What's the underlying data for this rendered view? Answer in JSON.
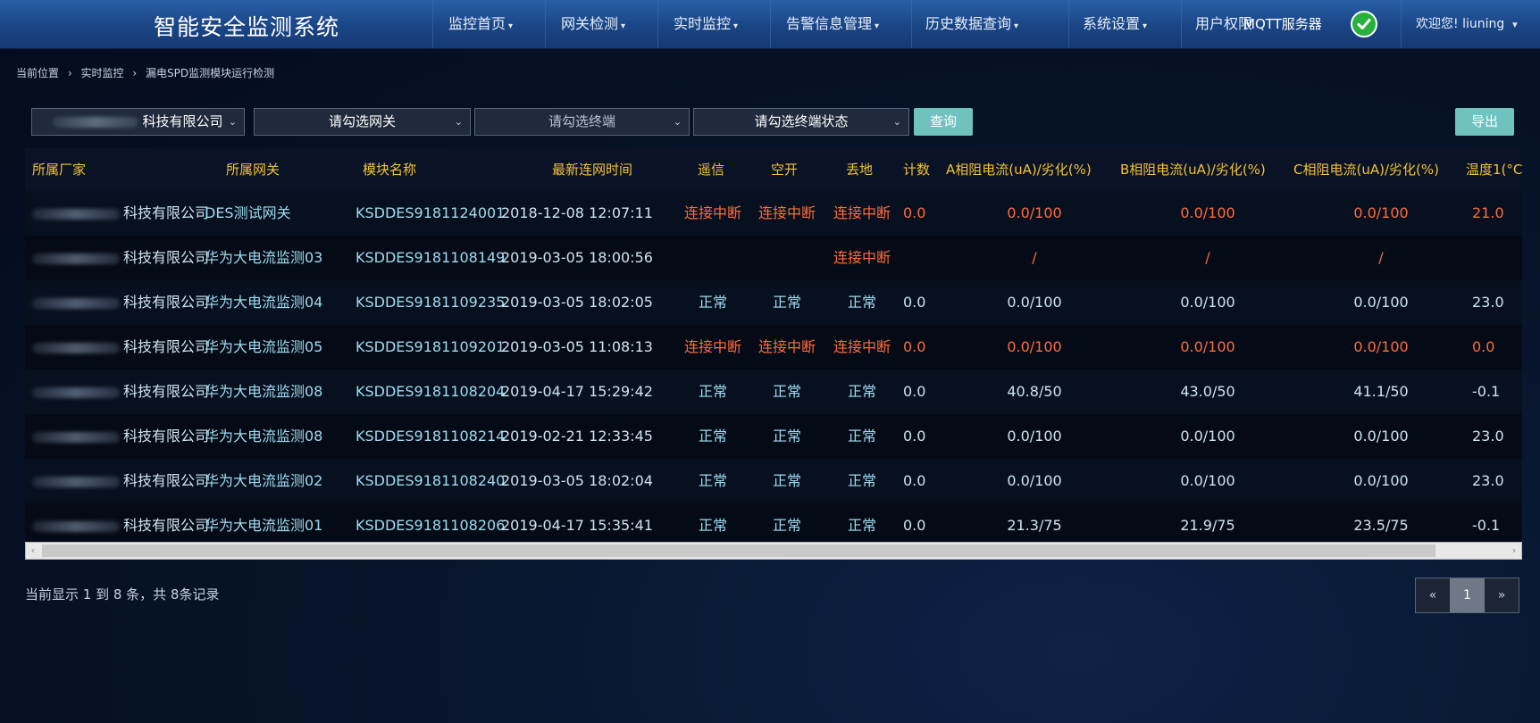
{
  "app": {
    "title": "智能安全监测系统"
  },
  "nav": [
    {
      "label": "监控首页",
      "caret": "▾"
    },
    {
      "label": "网关检测",
      "caret": "▾"
    },
    {
      "label": "实时监控",
      "caret": "▾"
    },
    {
      "label": "告警信息管理",
      "caret": "▾"
    },
    {
      "label": "历史数据查询",
      "caret": "▾"
    },
    {
      "label": "系统设置",
      "caret": "▾"
    },
    {
      "label": "用户权限"
    }
  ],
  "mqtt": {
    "label": "MQTT服务器",
    "status": "ok"
  },
  "user": {
    "welcome": "欢迎您!",
    "name": "liuning",
    "caret": "▾"
  },
  "breadcrumb": [
    "当前位置",
    "›",
    "实时监控",
    "›",
    "漏电SPD监测模块运行检测"
  ],
  "filters": {
    "company": "科技有限公司",
    "gateway_placeholder": "请勾选网关",
    "terminal_placeholder": "请勾选终端",
    "status_placeholder": "请勾选终端状态",
    "query_label": "查询",
    "export_label": "导出",
    "arrow": "⌄"
  },
  "table": {
    "headers": [
      "所属厂家",
      "所属网关",
      "模块名称",
      "最新连网时间",
      "遥信",
      "空开",
      "丢地",
      "计数",
      "A相阻电流(uA)/劣化(%)",
      "B相阻电流(uA)/劣化(%)",
      "C相阻电流(uA)/劣化(%)",
      "温度1(°C"
    ],
    "rows": [
      {
        "company": "科技有限公司",
        "gateway": "DES测试网关",
        "module": "KSDDES9181124001",
        "time": "2018-12-08 12:07:11",
        "remote": "连接中断",
        "switch": "连接中断",
        "ground": "连接中断",
        "count": "0.0",
        "a": "0.0/100",
        "b": "0.0/100",
        "c": "0.0/100",
        "temp": "21.0",
        "alarm": true
      },
      {
        "company": "科技有限公司",
        "gateway": "华为大电流监测03",
        "module": "KSDDES9181108149",
        "time": "2019-03-05 18:00:56",
        "remote": "",
        "switch": "",
        "ground": "连接中断",
        "count": "",
        "a": "/",
        "b": "/",
        "c": "/",
        "temp": "",
        "alarm": true
      },
      {
        "company": "科技有限公司",
        "gateway": "华为大电流监测04",
        "module": "KSDDES9181109235",
        "time": "2019-03-05 18:02:05",
        "remote": "正常",
        "switch": "正常",
        "ground": "正常",
        "count": "0.0",
        "a": "0.0/100",
        "b": "0.0/100",
        "c": "0.0/100",
        "temp": "23.0",
        "alarm": false
      },
      {
        "company": "科技有限公司",
        "gateway": "华为大电流监测05",
        "module": "KSDDES9181109201",
        "time": "2019-03-05 11:08:13",
        "remote": "连接中断",
        "switch": "连接中断",
        "ground": "连接中断",
        "count": "0.0",
        "a": "0.0/100",
        "b": "0.0/100",
        "c": "0.0/100",
        "temp": "0.0",
        "alarm": true
      },
      {
        "company": "科技有限公司",
        "gateway": "华为大电流监测08",
        "module": "KSDDES9181108204",
        "time": "2019-04-17 15:29:42",
        "remote": "正常",
        "switch": "正常",
        "ground": "正常",
        "count": "0.0",
        "a": "40.8/50",
        "b": "43.0/50",
        "c": "41.1/50",
        "temp": "-0.1",
        "alarm": false
      },
      {
        "company": "科技有限公司",
        "gateway": "华为大电流监测08",
        "module": "KSDDES9181108214",
        "time": "2019-02-21 12:33:45",
        "remote": "正常",
        "switch": "正常",
        "ground": "正常",
        "count": "0.0",
        "a": "0.0/100",
        "b": "0.0/100",
        "c": "0.0/100",
        "temp": "23.0",
        "alarm": false
      },
      {
        "company": "科技有限公司",
        "gateway": "华为大电流监测02",
        "module": "KSDDES9181108240",
        "time": "2019-03-05 18:02:04",
        "remote": "正常",
        "switch": "正常",
        "ground": "正常",
        "count": "0.0",
        "a": "0.0/100",
        "b": "0.0/100",
        "c": "0.0/100",
        "temp": "23.0",
        "alarm": false
      },
      {
        "company": "科技有限公司",
        "gateway": "华为大电流监测01",
        "module": "KSDDES9181108206",
        "time": "2019-04-17 15:35:41",
        "remote": "正常",
        "switch": "正常",
        "ground": "正常",
        "count": "0.0",
        "a": "21.3/75",
        "b": "21.9/75",
        "c": "23.5/75",
        "temp": "-0.1",
        "alarm": false
      }
    ]
  },
  "scroll": {
    "left": "‹",
    "right": "›"
  },
  "footer": {
    "info": "当前显示 1 到 8 条，共 8条记录"
  },
  "pager": {
    "prev": "«",
    "current": "1",
    "next": "»"
  },
  "colors": {
    "header_text": "#f2c136",
    "alarm": "#ff6a3d",
    "normal": "#9fdcef",
    "accent": "#6fc2c0"
  }
}
